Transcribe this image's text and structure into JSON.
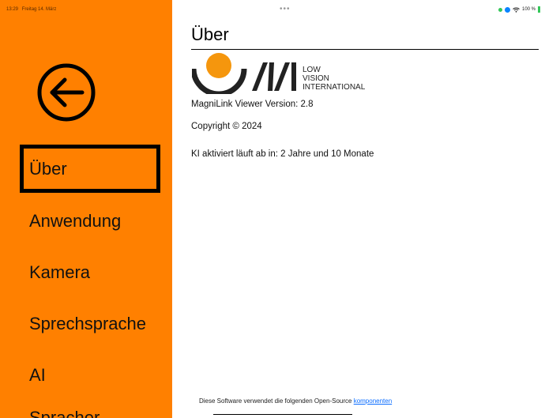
{
  "status_bar": {
    "time": "13:29",
    "date": "Freitag 14. März",
    "dots": "•••",
    "battery": "100 %"
  },
  "sidebar": {
    "items": [
      {
        "label": "Über",
        "selected": true
      },
      {
        "label": "Anwendung"
      },
      {
        "label": "Kamera"
      },
      {
        "label": "Sprechsprache"
      },
      {
        "label": "AI"
      },
      {
        "label": "Spracher..."
      }
    ]
  },
  "main": {
    "title": "Über",
    "logo": {
      "mark": "LVI",
      "line1": "LOW",
      "line2": "VISION",
      "line3": "INTERNATIONAL"
    },
    "version": "MagniLink Viewer Version: 2.8",
    "copyright": "Copyright © 2024",
    "ki": "KI aktiviert läuft ab in: 2 Jahre und 10 Monate",
    "footer_text": "Diese Software verwendet die folgenden Open-Source",
    "footer_link": "komponenten"
  },
  "colors": {
    "sidebar": "#ff8000",
    "accent_circle": "#f5960d",
    "link": "#0a6cff"
  }
}
